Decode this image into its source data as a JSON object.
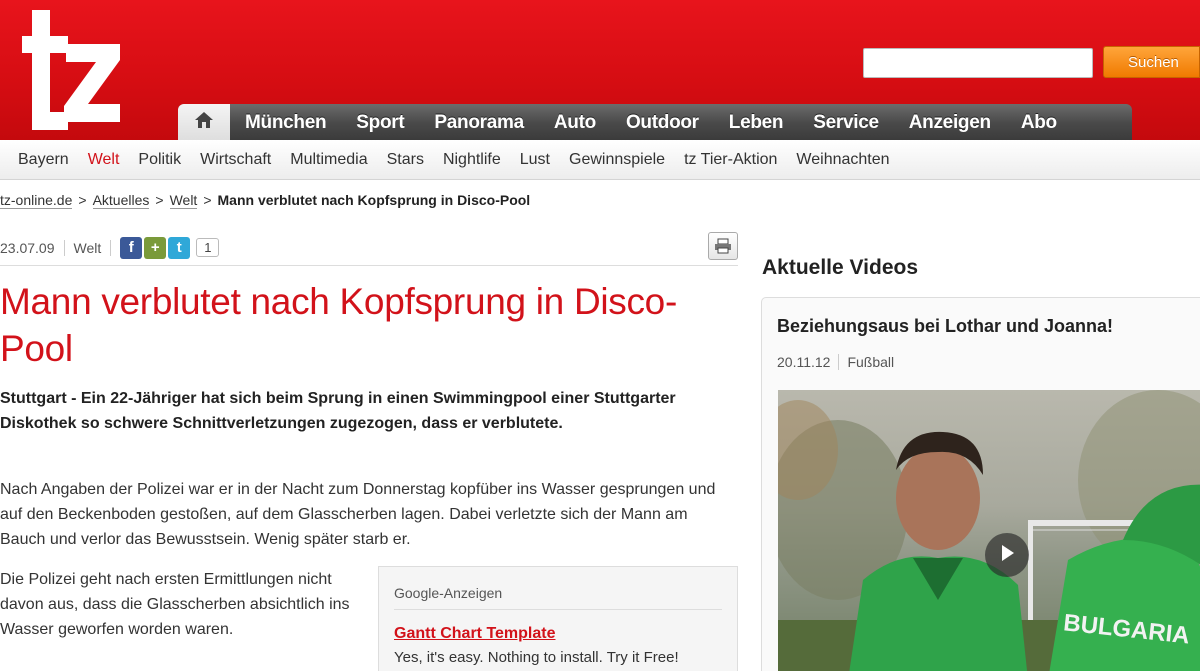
{
  "header": {
    "logo_text": "tz",
    "search": {
      "placeholder": "",
      "button_label": "Suchen"
    },
    "main_nav": [
      "München",
      "Sport",
      "Panorama",
      "Auto",
      "Outdoor",
      "Leben",
      "Service",
      "Anzeigen",
      "Abo"
    ],
    "sub_nav": [
      "Bayern",
      "Welt",
      "Politik",
      "Wirtschaft",
      "Multimedia",
      "Stars",
      "Nightlife",
      "Lust",
      "Gewinnspiele",
      "tz Tier-Aktion",
      "Weihnachten"
    ],
    "sub_nav_active": "Welt"
  },
  "breadcrumb": {
    "items": [
      "tz-online.de",
      "Aktuelles",
      "Welt"
    ],
    "separator": ">",
    "current": "Mann verblutet nach Kopfsprung in Disco-Pool"
  },
  "article": {
    "date": "23.07.09",
    "section": "Welt",
    "share_count": "1",
    "headline": "Mann verblutet nach Kopfsprung in Disco-Pool",
    "lead": "Stuttgart - Ein 22-Jähriger hat sich beim Sprung in einen Swimmingpool einer Stuttgarter Diskothek so schwere Schnittverletzungen zugezogen, dass er verblutete.",
    "paragraph_1": "Nach Angaben der Polizei war er in der Nacht zum Donnerstag kopfüber ins Wasser gesprungen und auf den Beckenboden gestoßen, auf dem Glasscherben lagen. Dabei verletzte sich der Mann am Bauch und verlor das Bewusstsein. Wenig später starb er.",
    "paragraph_2": "Die Polizei geht nach ersten Ermittlungen nicht davon aus, dass die Glasscherben absichtlich ins Wasser geworfen worden waren."
  },
  "ads": {
    "title": "Google-Anzeigen",
    "link": "Gantt Chart Template",
    "text": "Yes, it's easy. Nothing to install. Try it Free!"
  },
  "sidebar": {
    "title": "Aktuelle Videos",
    "video": {
      "title": "Beziehungsaus bei Lothar und Joanna!",
      "date": "20.11.12",
      "category": "Fußball",
      "jersey_text": "BULGARIA"
    }
  },
  "colors": {
    "brand_red": "#d2121a",
    "nav_dark": "#4a4a4a",
    "search_orange": "#f07a00"
  },
  "icons": [
    "home-icon",
    "facebook-icon",
    "plus-share-icon",
    "twitter-icon",
    "print-icon",
    "play-icon"
  ]
}
